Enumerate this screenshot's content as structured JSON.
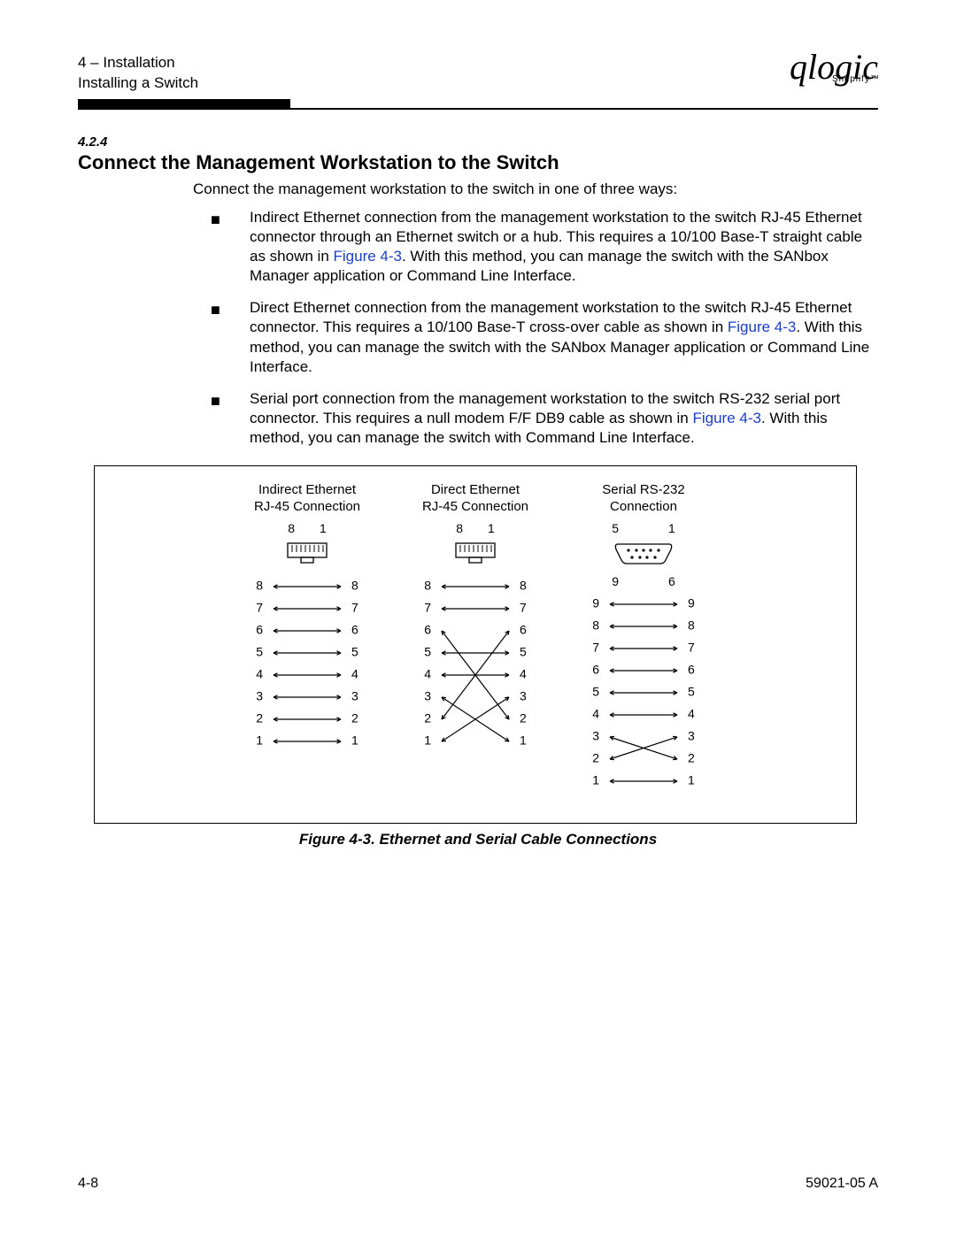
{
  "header": {
    "chapter": "4 – Installation",
    "section": "Installing a Switch",
    "logo_text": "qlogic",
    "logo_sub": "Simplify™"
  },
  "section_number": "4.2.4",
  "title": "Connect the Management Workstation to the Switch",
  "intro": "Connect the management workstation to the switch in one of three ways:",
  "bullets": [
    {
      "pre": "Indirect Ethernet connection from the management workstation to the switch RJ-45 Ethernet connector through an Ethernet switch or a hub. This requires a 10/100 Base-T straight cable as shown in ",
      "xref": "Figure 4-3",
      "post": ". With this method, you can manage the switch with the SANbox Manager application or Command Line Interface."
    },
    {
      "pre": "Direct Ethernet connection from the management workstation to the switch RJ-45 Ethernet connector. This requires a 10/100 Base-T cross-over cable as shown in ",
      "xref": "Figure 4-3",
      "post": ". With this method, you can manage the switch with the SANbox Manager application or Command Line Interface."
    },
    {
      "pre": "Serial port connection from the management workstation to the switch RS-232 serial port connector. This requires a null modem F/F DB9 cable as shown in ",
      "xref": "Figure 4-3",
      "post": ". With this method, you can manage the switch with Command Line Interface."
    }
  ],
  "figure": {
    "col1_title_a": "Indirect Ethernet",
    "col1_title_b": "RJ-45 Connection",
    "col2_title_a": "Direct Ethernet",
    "col2_title_b": "RJ-45 Connection",
    "col3_title_a": "Serial RS-232",
    "col3_title_b": "Connection",
    "rj45_top_left": "8",
    "rj45_top_right": "1",
    "db9_top_left": "5",
    "db9_top_right": "1",
    "db9_bot_left": "9",
    "db9_bot_right": "6",
    "caption": "Figure 4-3.  Ethernet and Serial Cable Connections"
  },
  "footer": {
    "page": "4-8",
    "doc": "59021-05  A"
  },
  "chart_data": [
    {
      "type": "table",
      "title": "Indirect Ethernet RJ-45 Connection (straight-through)",
      "columns": [
        "left_pin",
        "right_pin"
      ],
      "rows": [
        [
          8,
          8
        ],
        [
          7,
          7
        ],
        [
          6,
          6
        ],
        [
          5,
          5
        ],
        [
          4,
          4
        ],
        [
          3,
          3
        ],
        [
          2,
          2
        ],
        [
          1,
          1
        ]
      ]
    },
    {
      "type": "table",
      "title": "Direct Ethernet RJ-45 Connection (cross-over)",
      "columns": [
        "left_pin",
        "right_pin"
      ],
      "rows": [
        [
          8,
          8
        ],
        [
          7,
          7
        ],
        [
          6,
          2
        ],
        [
          5,
          5
        ],
        [
          4,
          4
        ],
        [
          3,
          1
        ],
        [
          2,
          6
        ],
        [
          1,
          3
        ]
      ]
    },
    {
      "type": "table",
      "title": "Serial RS-232 Connection (null modem)",
      "columns": [
        "left_pin",
        "right_pin"
      ],
      "rows": [
        [
          9,
          9
        ],
        [
          8,
          8
        ],
        [
          7,
          7
        ],
        [
          6,
          6
        ],
        [
          5,
          5
        ],
        [
          4,
          4
        ],
        [
          3,
          2
        ],
        [
          2,
          3
        ],
        [
          1,
          1
        ]
      ]
    }
  ]
}
